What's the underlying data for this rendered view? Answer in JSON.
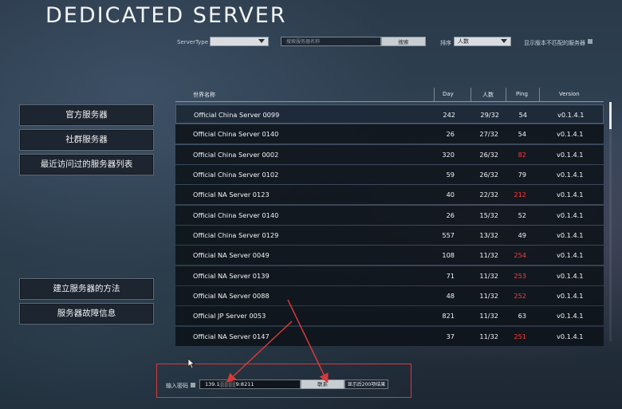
{
  "title": "DEDICATED SERVER",
  "filters": {
    "server_type_label": "ServerType",
    "server_type_value": "",
    "search_placeholder": "搜索服务器名称",
    "search_button": "搜索",
    "sort_label": "排序",
    "sort_value": "人数",
    "mismatch_label": "显示版本不匹配的服务器"
  },
  "menu": {
    "official": "官方服务器",
    "community": "社群服务器",
    "recent": "最近访问过的服务器列表",
    "howto": "建立服务器的方法",
    "trouble": "服务器故障信息"
  },
  "table": {
    "headers": {
      "name": "世界名称",
      "day": "Day",
      "players": "人数",
      "ping": "Ping",
      "version": "Version"
    },
    "rows": [
      {
        "name": "Official China Server 0099",
        "day": "242",
        "players": "29/32",
        "ping": "54",
        "version": "v0.1.4.1",
        "ping_high": false
      },
      {
        "name": "Official China Server 0140",
        "day": "26",
        "players": "27/32",
        "ping": "54",
        "version": "v0.1.4.1",
        "ping_high": false
      },
      {
        "name": "Official China Server 0002",
        "day": "320",
        "players": "26/32",
        "ping": "82",
        "version": "v0.1.4.1",
        "ping_high": true
      },
      {
        "name": "Official China Server 0102",
        "day": "59",
        "players": "26/32",
        "ping": "79",
        "version": "v0.1.4.1",
        "ping_high": false
      },
      {
        "name": "Official NA Server 0123",
        "day": "40",
        "players": "22/32",
        "ping": "212",
        "version": "v0.1.4.1",
        "ping_high": true
      },
      {
        "name": "Official China Server 0140",
        "day": "26",
        "players": "15/32",
        "ping": "52",
        "version": "v0.1.4.1",
        "ping_high": false
      },
      {
        "name": "Official China Server 0129",
        "day": "557",
        "players": "13/32",
        "ping": "49",
        "version": "v0.1.4.1",
        "ping_high": false
      },
      {
        "name": "Official NA Server 0049",
        "day": "108",
        "players": "11/32",
        "ping": "254",
        "version": "v0.1.4.1",
        "ping_high": true
      },
      {
        "name": "Official NA Server 0139",
        "day": "71",
        "players": "11/32",
        "ping": "253",
        "version": "v0.1.4.1",
        "ping_high": true
      },
      {
        "name": "Official NA Server 0088",
        "day": "48",
        "players": "11/32",
        "ping": "252",
        "version": "v0.1.4.1",
        "ping_high": true
      },
      {
        "name": "Official JP Server 0053",
        "day": "821",
        "players": "11/32",
        "ping": "63",
        "version": "v0.1.4.1",
        "ping_high": false
      },
      {
        "name": "Official NA Server 0147",
        "day": "37",
        "players": "11/32",
        "ping": "251",
        "version": "v0.1.4.1",
        "ping_high": true
      }
    ]
  },
  "bottom": {
    "password_label": "输入密码",
    "address_value": "139.1░░░░9:8211",
    "connect_button": "联系",
    "more_button": "显示后200项结果"
  },
  "colors": {
    "ping_high": "#ff3a3a",
    "annotation": "#d73a3a"
  },
  "icons": {
    "dropdown": "chevron-down-icon",
    "checkbox": "checkbox-icon",
    "cursor": "mouse-cursor-icon"
  }
}
